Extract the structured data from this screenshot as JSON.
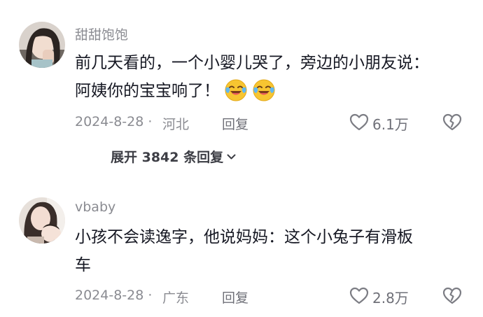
{
  "comments": [
    {
      "username": "甜甜饱饱",
      "lines": [
        "前几天看的，一个小婴儿哭了，旁边的小朋友说：",
        "阿姨你的宝宝响了！"
      ],
      "emojis": [
        "crying-laughing-emoji",
        "crying-laughing-emoji"
      ],
      "date": "2024-8-28 ·",
      "location": "河北",
      "reply_label": "回复",
      "like_count": "6.1万",
      "expand_label": "展开 3842 条回复"
    },
    {
      "username": "vbaby",
      "lines": [
        "小孩不会读逸字，他说妈妈：这个小兔子有滑板",
        "车"
      ],
      "date": "2024-8-28 ·",
      "location": "广东",
      "reply_label": "回复",
      "like_count": "2.8万"
    }
  ],
  "colors": {
    "text_primary": "#161823",
    "text_secondary": "#8a8b91",
    "icon_gray": "#7c7d84",
    "background": "#ffffff"
  },
  "icons": [
    "heart-outline-icon",
    "broken-heart-icon",
    "chevron-down-icon"
  ]
}
